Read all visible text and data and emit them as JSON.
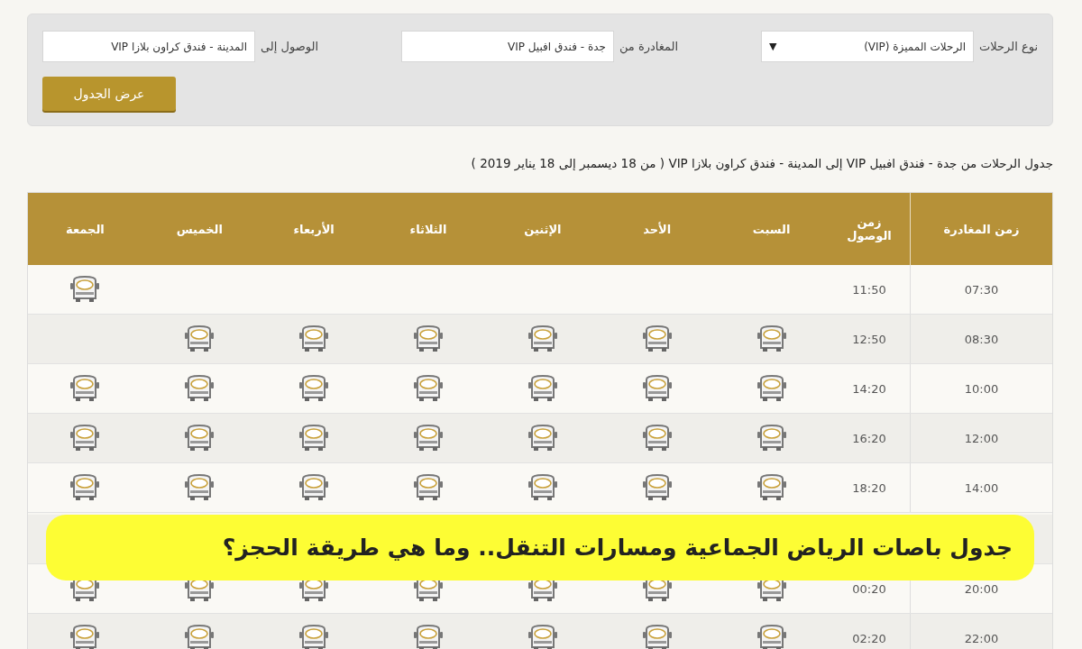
{
  "search_form": {
    "fields": [
      {
        "label": "نوع الرحلات",
        "kind": "select",
        "value": "الرحلات المميزة (VIP)",
        "caret": "▼"
      },
      {
        "label": "المغادرة من",
        "kind": "text",
        "value": "جدة - فندق افبيل VIP"
      },
      {
        "label": "الوصول إلى",
        "kind": "text",
        "value": "المدينة - فندق كراون بلازا VIP"
      }
    ],
    "button": "عرض الجدول"
  },
  "schedule_title": "جدول الرحلات من جدة - فندق افبيل VIP إلى المدينة - فندق كراون بلازا VIP ( من 18 ديسمبر إلى 18 يناير 2019 )",
  "table": {
    "columns": [
      "زمن المغادرة",
      "زمن الوصول",
      "السبت",
      "الأحد",
      "الإثنين",
      "الثلاثاء",
      "الأربعاء",
      "الخميس",
      "الجمعة"
    ],
    "rows": [
      {
        "departure": "07:30",
        "arrival": "11:50",
        "trips": [
          false,
          false,
          false,
          false,
          false,
          false,
          true
        ]
      },
      {
        "departure": "08:30",
        "arrival": "12:50",
        "trips": [
          true,
          true,
          true,
          true,
          true,
          true,
          false
        ]
      },
      {
        "departure": "10:00",
        "arrival": "14:20",
        "trips": [
          true,
          true,
          true,
          true,
          true,
          true,
          true
        ]
      },
      {
        "departure": "12:00",
        "arrival": "16:20",
        "trips": [
          true,
          true,
          true,
          true,
          true,
          true,
          true
        ]
      },
      {
        "departure": "14:00",
        "arrival": "18:20",
        "trips": [
          true,
          true,
          true,
          true,
          true,
          true,
          true
        ]
      }
    ],
    "rows_below_banner": [
      {
        "departure": "20:00",
        "arrival": "00:20",
        "trips": [
          true,
          true,
          true,
          true,
          true,
          true,
          true
        ]
      },
      {
        "departure": "22:00",
        "arrival": "02:20",
        "trips": [
          true,
          true,
          true,
          true,
          true,
          true,
          true
        ]
      }
    ]
  },
  "banner": "جدول باصات الرياض الجماعية ومسارات التنقل.. وما هي طريقة الحجز؟"
}
